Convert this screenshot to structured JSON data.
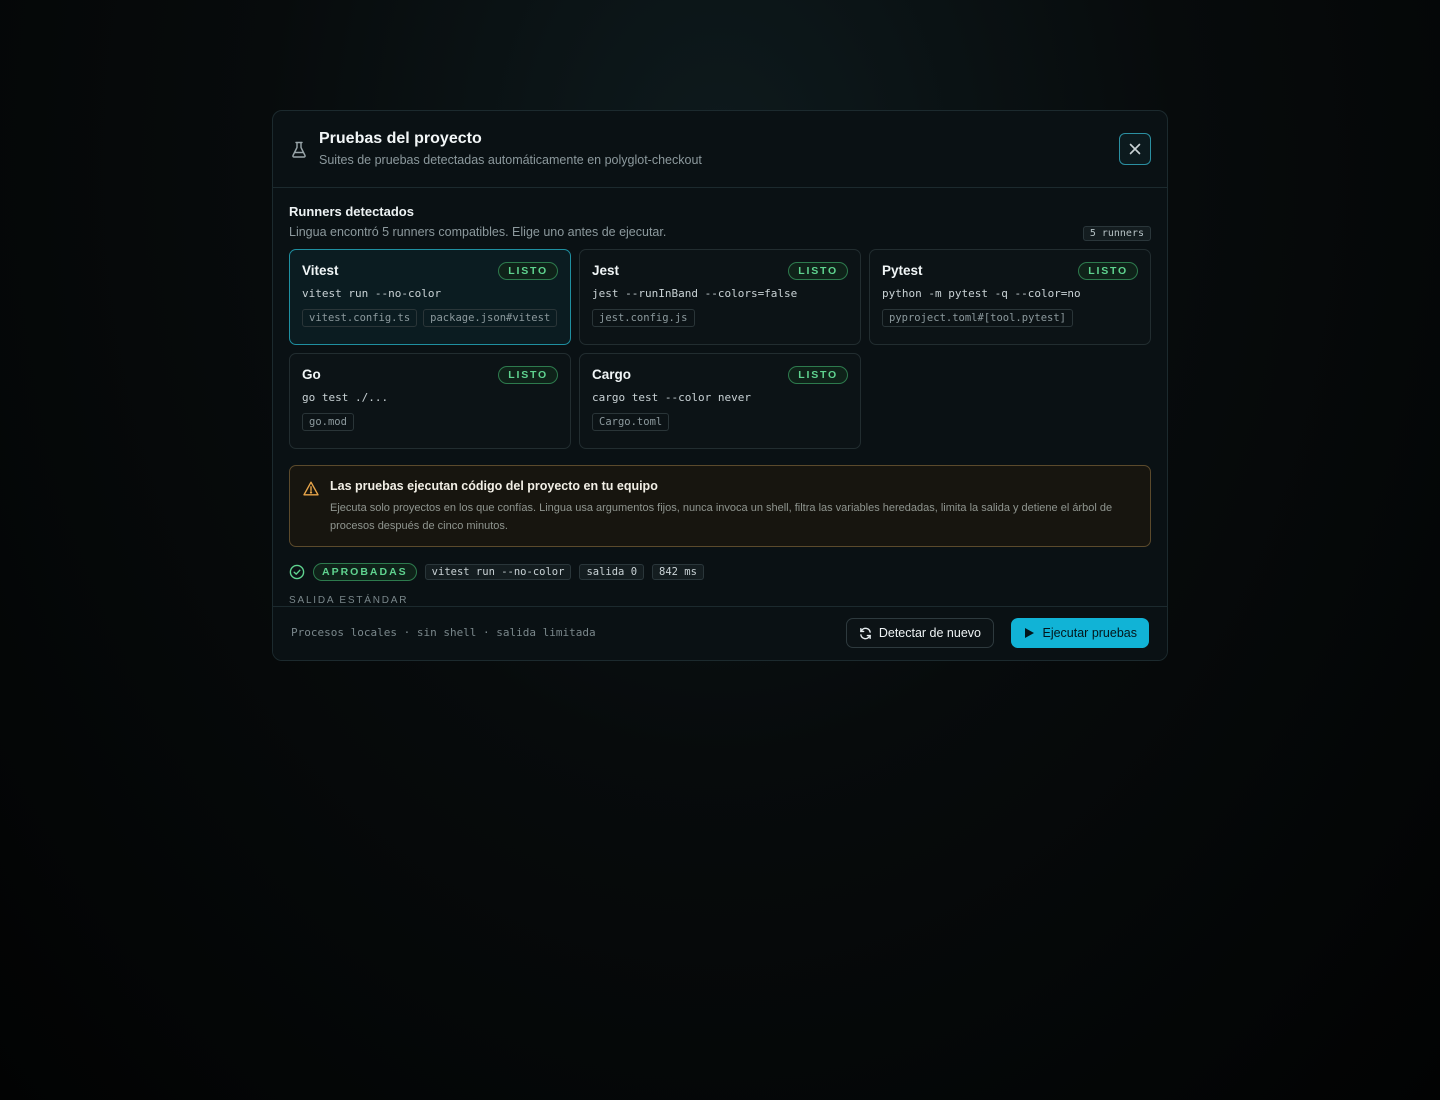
{
  "dialog": {
    "title": "Pruebas del proyecto",
    "subtitle": "Suites de pruebas detectadas automáticamente en polyglot-checkout",
    "close_icon": "close-icon",
    "header_icon": "flask-icon"
  },
  "runners_section": {
    "title": "Runners detectados",
    "description": "Lingua encontró 5 runners compatibles. Elige uno antes de ejecutar.",
    "count_badge": "5 runners"
  },
  "runners": [
    {
      "name": "Vitest",
      "status": "LISTO",
      "command": "vitest run --no-color",
      "files": [
        "vitest.config.ts",
        "package.json#vitest"
      ],
      "selected": true
    },
    {
      "name": "Jest",
      "status": "LISTO",
      "command": "jest --runInBand --colors=false",
      "files": [
        "jest.config.js"
      ],
      "selected": false
    },
    {
      "name": "Pytest",
      "status": "LISTO",
      "command": "python -m pytest -q --color=no",
      "files": [
        "pyproject.toml#[tool.pytest]"
      ],
      "selected": false
    },
    {
      "name": "Go",
      "status": "LISTO",
      "command": "go test ./...",
      "files": [
        "go.mod"
      ],
      "selected": false
    },
    {
      "name": "Cargo",
      "status": "LISTO",
      "command": "cargo test --color never",
      "files": [
        "Cargo.toml"
      ],
      "selected": false
    }
  ],
  "warning": {
    "title": "Las pruebas ejecutan código del proyecto en tu equipo",
    "text": "Ejecuta solo proyectos en los que confías. Lingua usa argumentos fijos, nunca invoca un shell, filtra las variables heredadas, limita la salida y detiene el árbol de procesos después de cinco minutos."
  },
  "result": {
    "status": "APROBADAS",
    "command": "vitest run --no-color",
    "exit": "salida 0",
    "duration": "842 ms",
    "stdout_label": "SALIDA ESTÁNDAR"
  },
  "footer": {
    "note": "Procesos locales · sin shell · salida limitada",
    "redetect_label": "Detectar de nuevo",
    "run_label": "Ejecutar pruebas"
  },
  "colors": {
    "accent": "#11b3d6",
    "success": "#5fd38f",
    "warning": "#e8a54a"
  }
}
